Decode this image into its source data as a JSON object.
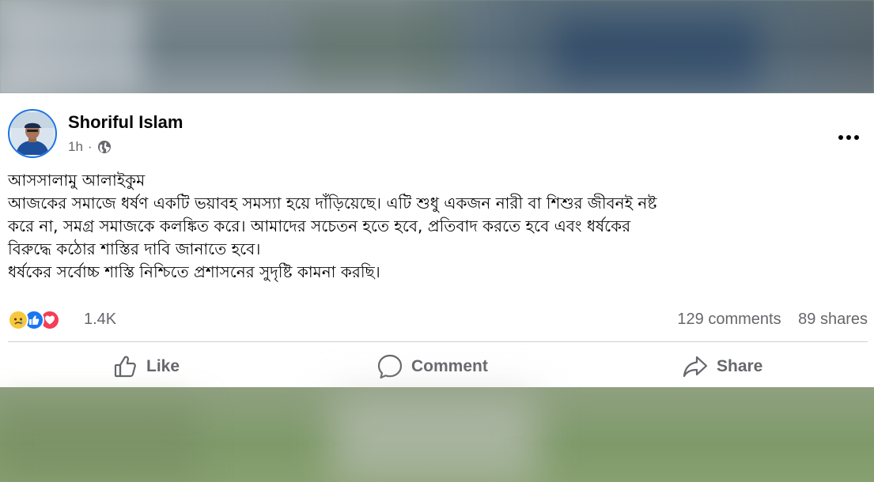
{
  "post": {
    "author": "Shoriful Islam",
    "time": "1h",
    "separator": "·",
    "privacy_icon": "globe-icon",
    "more_icon": "more-horizontal-icon",
    "text_lines": [
      "আসসালামু আলাইকুম",
      "আজকের সমাজে ধর্ষণ একটি ভয়াবহ সমস্যা হয়ে দাঁড়িয়েছে। এটি শুধু একজন নারী বা শিশুর জীবনই নষ্ট",
      "করে না, সমগ্র সমাজকে কলঙ্কিত করে। আমাদের সচেতন হতে হবে, প্রতিবাদ করতে হবে এবং ধর্ষকের",
      "বিরুদ্ধে কঠোর শাস্তির দাবি জানাতে হবে।",
      "ধর্ষকের সর্বোচ্চ শাস্তি নিশ্চিতে প্রশাসনের সুদৃষ্টি   কামনা করছি।"
    ]
  },
  "stats": {
    "reactions": [
      "sad-icon",
      "like-icon",
      "love-icon"
    ],
    "reaction_count": "1.4K",
    "comments": "129 comments",
    "shares": "89 shares"
  },
  "actions": {
    "like": "Like",
    "comment": "Comment",
    "share": "Share"
  },
  "colors": {
    "accent": "#1b74e4",
    "text": "#050505",
    "muted": "#65676b",
    "like": "#1877f2",
    "love": "#f33e58",
    "sad": "#f7c73e"
  }
}
